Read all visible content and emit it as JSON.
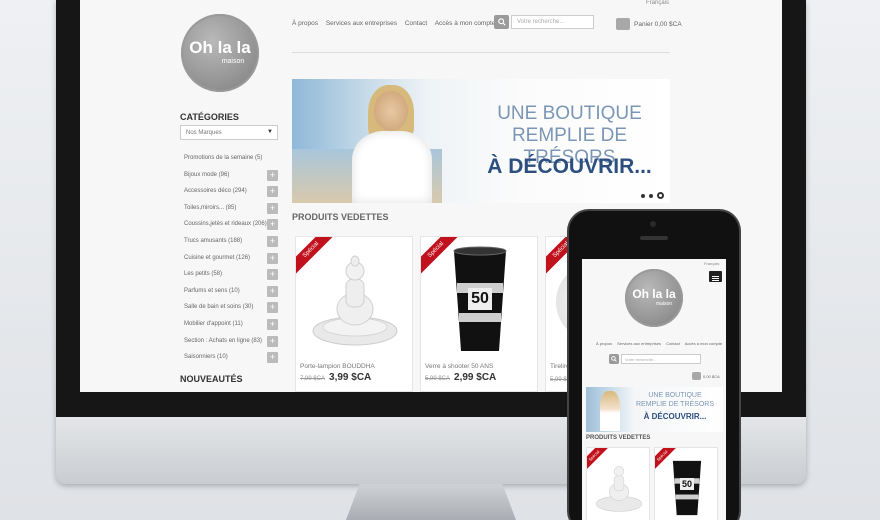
{
  "site": {
    "logo": {
      "line1": "Oh la la",
      "line2": "maison"
    },
    "language": "Français",
    "nav": [
      "À propos",
      "Services aux entreprises",
      "Contact",
      "Accès à mon compte"
    ],
    "search_placeholder": "Votre recherche...",
    "cart_label": "Panier 0,00 $CA",
    "phone_cart": "0,00 $CA"
  },
  "sidebar": {
    "title": "CATÉGORIES",
    "select_value": "Nos Marques",
    "categories": [
      "Promotions de la semaine (5)",
      "Bijoux mode (96)",
      "Accessoires déco (294)",
      "Toiles,miroirs... (85)",
      "Coussins,jetés et rideaux (206)",
      "Trucs amusants (188)",
      "Cuisine et gourmet (126)",
      "Les petits (58)",
      "Parfums et sens (10)",
      "Salle de bain et soins (30)",
      "Mobilier d'appoint (11)",
      "Section : Achats en ligne (83)",
      "Saisonniers (10)"
    ],
    "nouveautes": "NOUVEAUTÉS"
  },
  "banner": {
    "line1": "UNE BOUTIQUE",
    "line2": "REMPLIE DE TRÉSORS",
    "line3": "À DÉCOUVRIR..."
  },
  "featured_title": "PRODUITS VEDETTES",
  "products": [
    {
      "badge": "Spécial",
      "name": "Porte-lampion BOUDDHA",
      "old_price": "7,99 $CA",
      "price": "3,99 $CA"
    },
    {
      "badge": "Spécial",
      "name": "Verre à shooter 50 ANS",
      "old_price": "5,99 $CA",
      "price": "2,99 $CA"
    },
    {
      "badge": "Spécial",
      "name": "Tirelire",
      "old_price": "5,99 $CA",
      "price": ""
    }
  ],
  "shot_glass_number": "50",
  "colors": {
    "ribbon": "#c0111c",
    "banner_navy": "#2c4f80",
    "banner_blue": "#7b96b5"
  }
}
